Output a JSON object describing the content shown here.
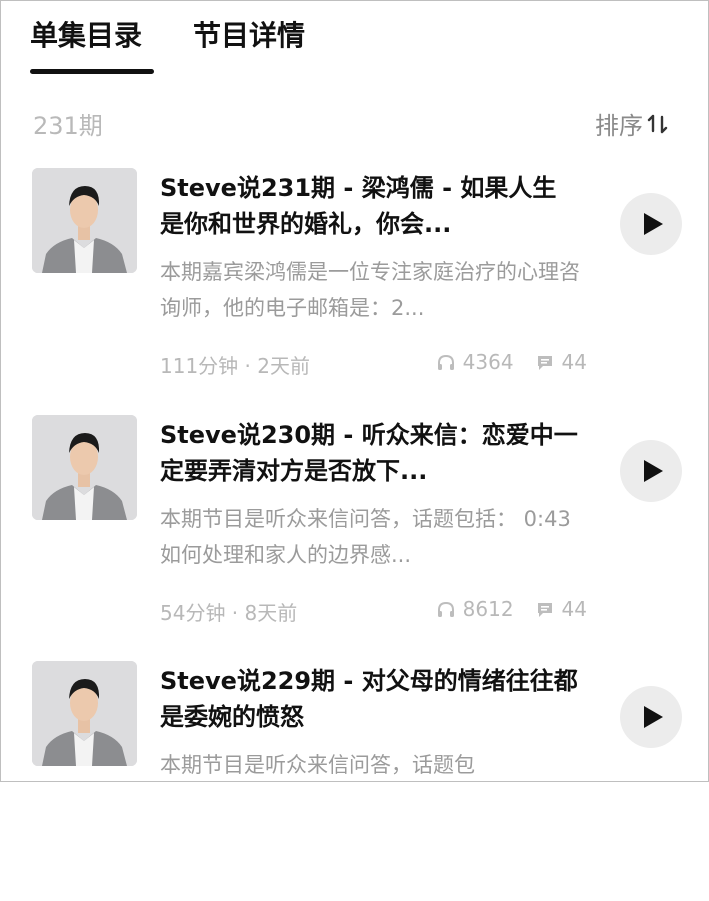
{
  "tabs": [
    {
      "label": "单集目录",
      "active": true
    },
    {
      "label": "节目详情",
      "active": false
    }
  ],
  "list_header": {
    "count": "231期",
    "sort_label": "排序",
    "sort_icon": "sort-arrows-icon"
  },
  "episodes": [
    {
      "title": "Steve说231期 - 梁鸿儒 - 如果人生是你和世界的婚礼，你会...",
      "description": "本期嘉宾梁鸿儒是一位专注家庭治疗的心理咨询师，他的电子邮箱是：2...",
      "duration": "111分钟",
      "time_ago": "2天前",
      "plays": "4364",
      "comments": "44"
    },
    {
      "title": "Steve说230期 - 听众来信：恋爱中一定要弄清对方是否放下...",
      "description": "本期节目是听众来信问答，话题包括： 0:43 如何处理和家人的边界感...",
      "duration": "54分钟",
      "time_ago": "8天前",
      "plays": "8612",
      "comments": "44"
    },
    {
      "title": "Steve说229期 - 对父母的情绪往往都是委婉的愤怒",
      "description": "本期节目是听众来信问答，话题包",
      "duration": "",
      "time_ago": "",
      "plays": "",
      "comments": ""
    }
  ],
  "meta_separator": " · ",
  "icons": {
    "play": "play-icon",
    "headphones": "headphones-icon",
    "comment": "comment-icon"
  },
  "colors": {
    "text_primary": "#111111",
    "text_secondary": "#9b9b9b",
    "play_button_bg": "#ececec"
  }
}
